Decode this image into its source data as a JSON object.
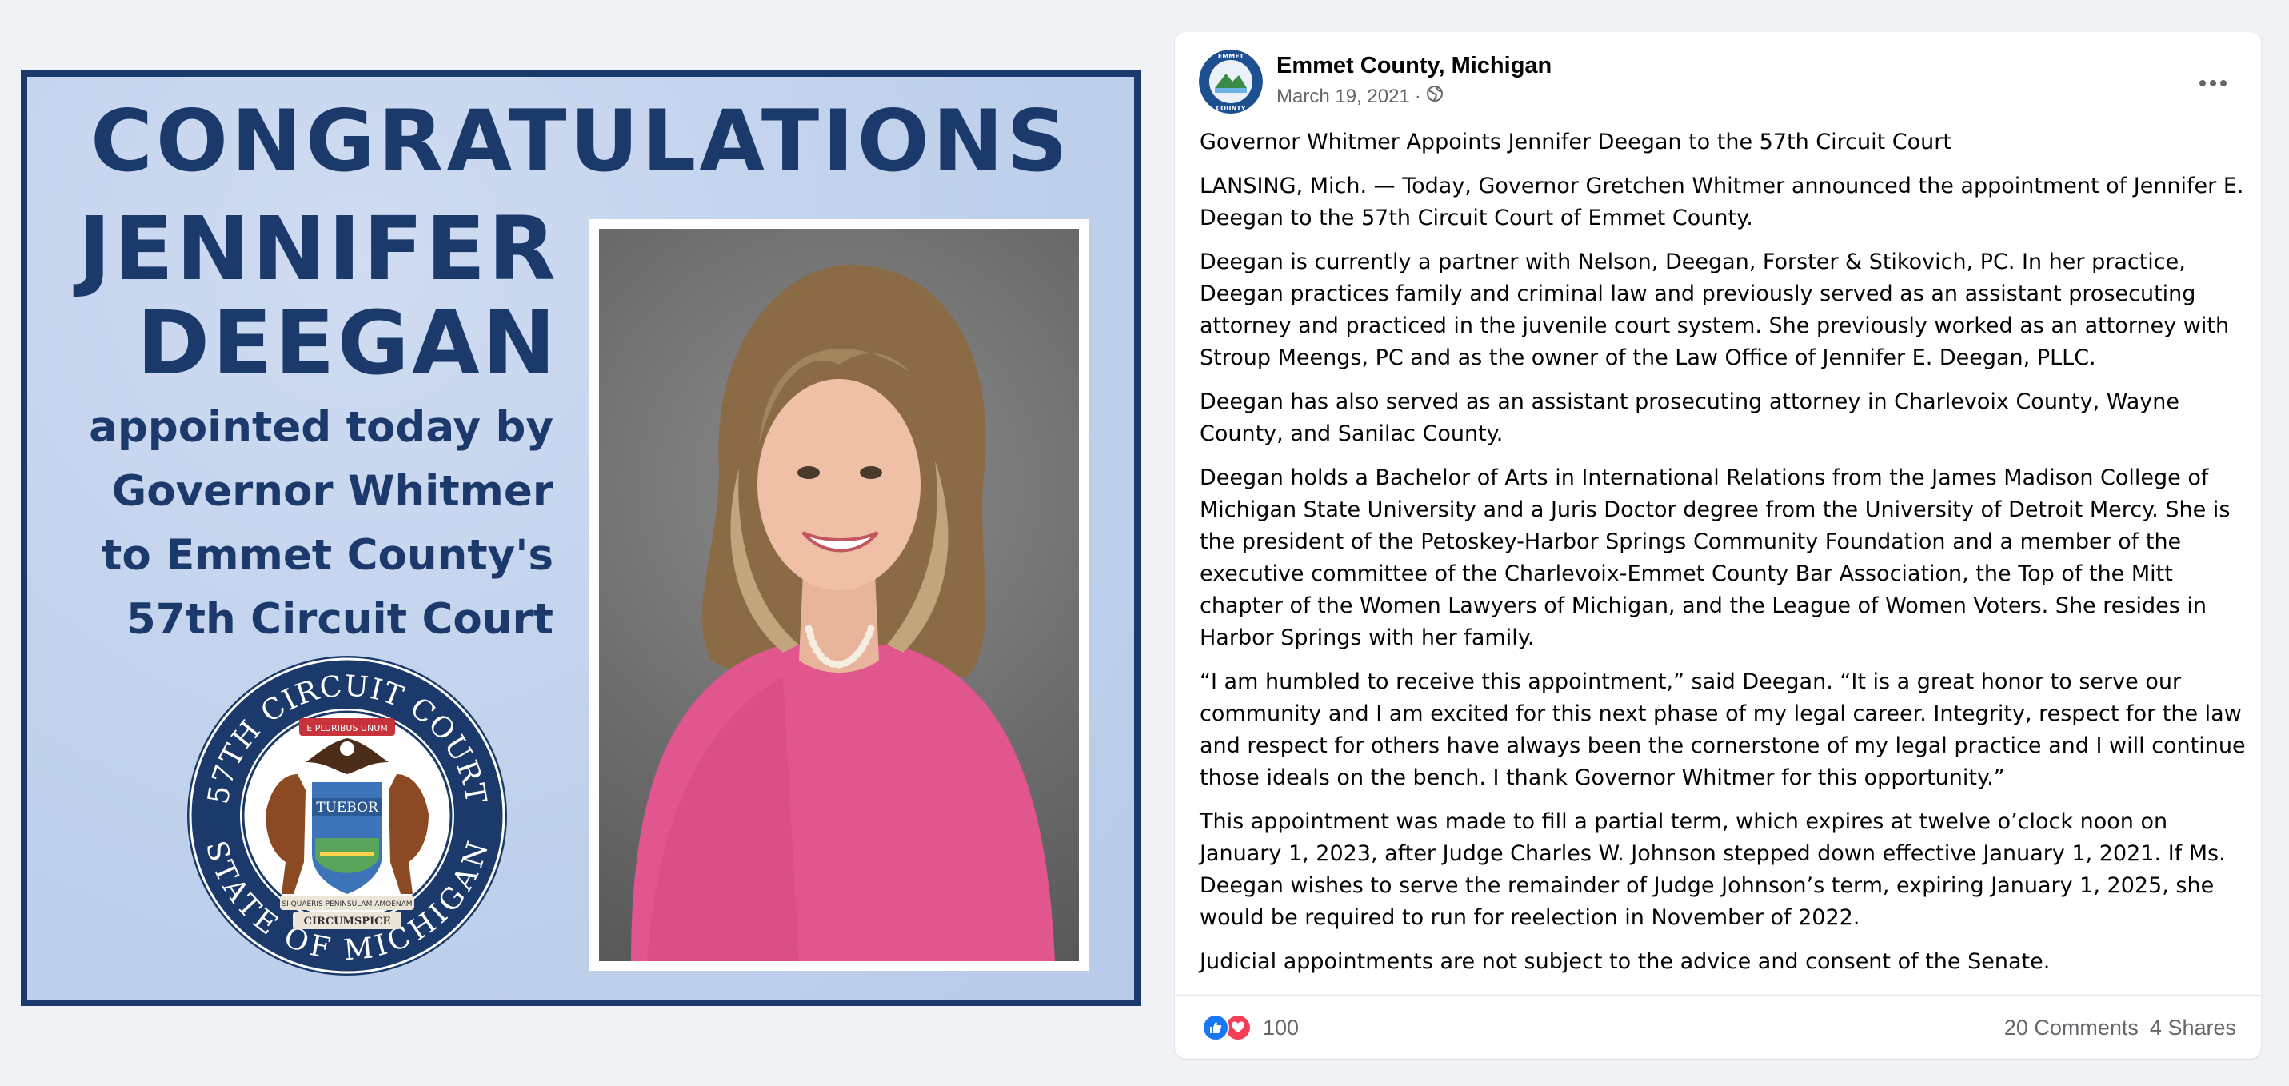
{
  "graphic": {
    "headline": "CONGRATULATIONS",
    "first_name": "JENNIFER",
    "last_name": "DEEGAN",
    "lines": [
      "appointed today by",
      "Governor Whitmer",
      "to Emmet County's",
      "57th Circuit Court"
    ],
    "seal": {
      "top_text": "57TH CIRCUIT COURT",
      "bottom_text": "STATE OF MICHIGAN",
      "ribbon_top": "E PLURIBUS UNUM",
      "shield_text": "TUEBOR",
      "ribbon_mid": "SI QUAERIS PENINSULAM AMOENAM",
      "ribbon_bottom": "CIRCUMSPICE"
    },
    "colors": {
      "navy": "#1b3a6b",
      "background": "#bfd0ec"
    }
  },
  "post": {
    "page_name": "Emmet County, Michigan",
    "date": "March 19, 2021",
    "separator": "·",
    "avatar_text_top": "EMMET",
    "avatar_text_bottom": "COUNTY",
    "paragraphs": [
      "Governor Whitmer Appoints Jennifer Deegan to the 57th Circuit Court",
      "LANSING, Mich. — Today, Governor Gretchen Whitmer announced the appointment of Jennifer E. Deegan to the 57th Circuit Court of Emmet County.",
      "Deegan is currently a partner with Nelson, Deegan, Forster & Stikovich, PC. In her practice, Deegan practices family and criminal law and previously served as an assistant prosecuting attorney and practiced in the juvenile court system. She previously worked as an attorney with Stroup Meengs, PC and as the owner of the Law Office of Jennifer E. Deegan, PLLC.",
      "Deegan has also served as an assistant prosecuting attorney in Charlevoix County, Wayne County, and Sanilac County.",
      "Deegan holds a Bachelor of Arts in International Relations from the James Madison College of Michigan State University and a Juris Doctor degree from the University of Detroit Mercy. She is the president of the Petoskey-Harbor Springs Community Foundation and a member of the executive committee of the Charlevoix-Emmet County Bar Association, the Top of the Mitt chapter of the Women Lawyers of Michigan, and the League of Women Voters. She resides in Harbor Springs with her family.",
      "“I am humbled to receive this appointment,” said Deegan. “It is a great honor to serve our community and I am excited for this next phase of my legal career. Integrity, respect for the law and respect for others have always been the cornerstone of my legal practice and I will continue those ideals on the bench. I thank Governor Whitmer for this opportunity.”",
      "This appointment was made to fill a partial term, which expires at twelve o’clock noon on January 1, 2023, after Judge Charles W. Johnson stepped down effective January 1, 2021. If Ms. Deegan wishes to serve the remainder of Judge Johnson’s term, expiring January 1, 2025, she would be required to run for reelection in November of 2022.",
      "Judicial appointments are not subject to the advice and consent of the Senate."
    ],
    "reaction_count": "100",
    "comments": "20 Comments",
    "shares": "4 Shares",
    "icons": [
      "globe-icon",
      "more-options-icon",
      "like-reaction-icon",
      "love-reaction-icon"
    ],
    "colors": {
      "like": "#1877f2",
      "love": "#f33e58",
      "secondary_text": "#65676b"
    }
  }
}
